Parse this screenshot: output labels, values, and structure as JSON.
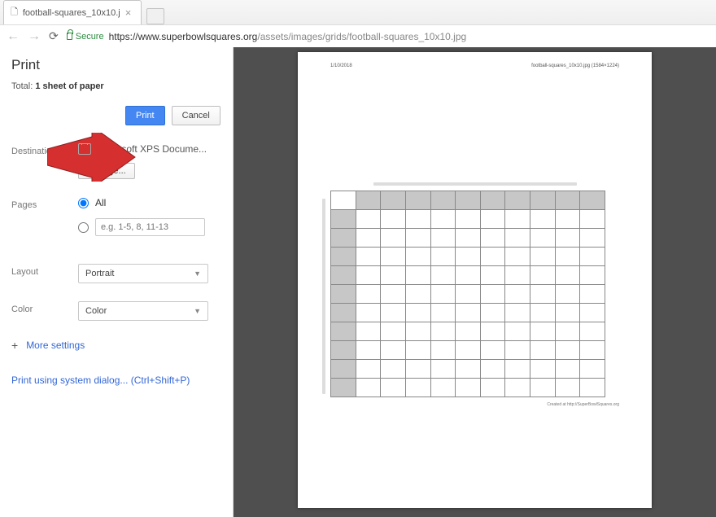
{
  "browser": {
    "tab_title": "football-squares_10x10.j",
    "secure_text": "Secure",
    "url_host": "https://www.superbowlsquares.org",
    "url_path": "/assets/images/grids/football-squares_10x10.jpg"
  },
  "print": {
    "title": "Print",
    "total_label": "Total:",
    "total_value": "1 sheet of paper",
    "print_btn": "Print",
    "cancel_btn": "Cancel",
    "destination": {
      "label": "Destination",
      "printer": "Microsoft XPS Docume...",
      "change": "Change..."
    },
    "pages": {
      "label": "Pages",
      "all": "All",
      "range_placeholder": "e.g. 1-5, 8, 11-13"
    },
    "layout": {
      "label": "Layout",
      "value": "Portrait"
    },
    "color": {
      "label": "Color",
      "value": "Color"
    },
    "more_settings": "More settings",
    "system_dialog": "Print using system dialog... (Ctrl+Shift+P)"
  },
  "preview": {
    "date": "1/10/2018",
    "header_filename": "football-squares_10x10.jpg (1584×1224)",
    "credit": "Created at http://SuperBowlSquares.org"
  }
}
